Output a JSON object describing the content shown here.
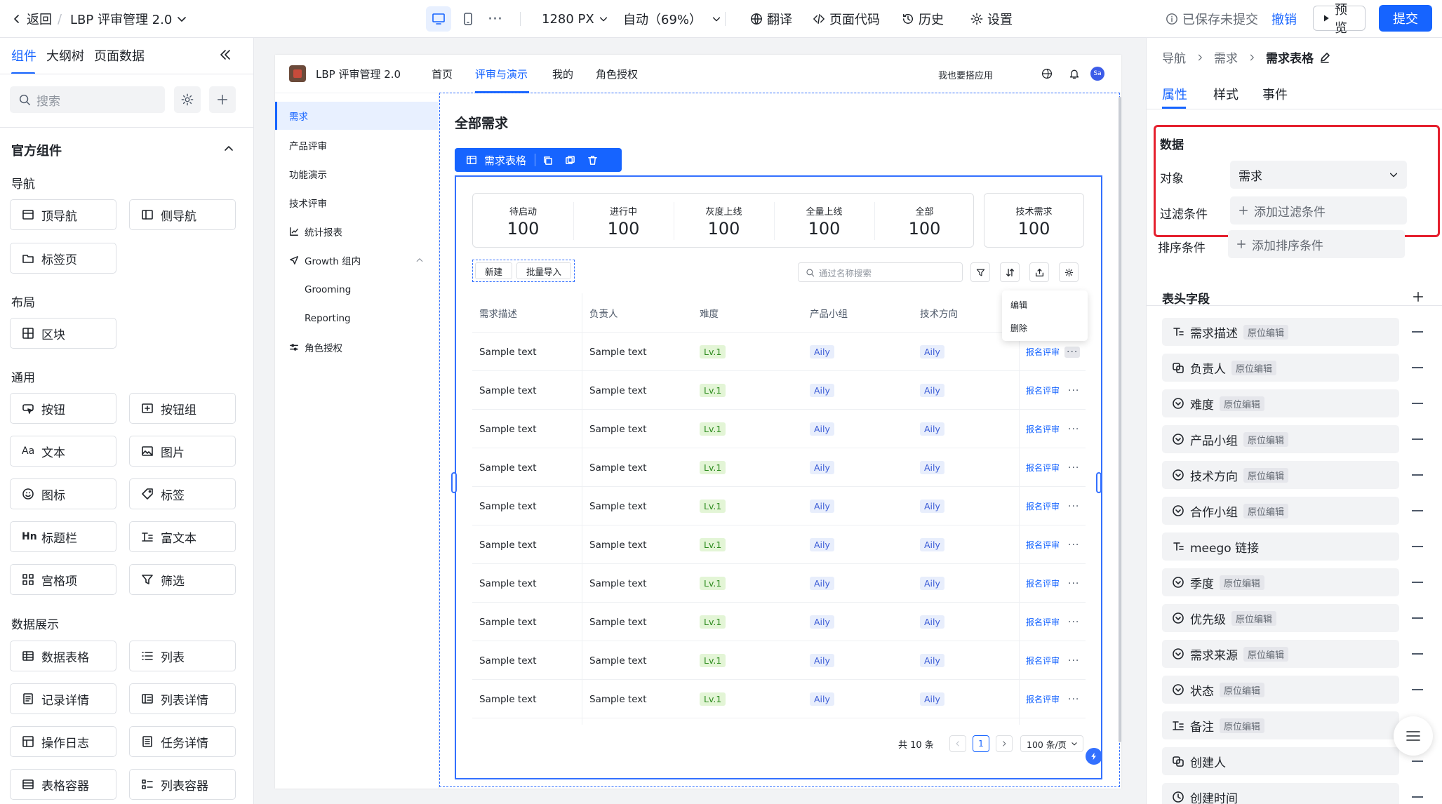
{
  "topbar": {
    "back": "返回",
    "breadcrumb_sep": "/",
    "app_title": "LBP 评审管理 2.0",
    "width": "1280 PX",
    "zoom": "自动（69%）",
    "translate": "翻译",
    "page_code": "页面代码",
    "history": "历史",
    "settings": "设置",
    "save_status": "已保存未提交",
    "undo": "撤销",
    "preview": "预览",
    "submit": "提交"
  },
  "left": {
    "tabs": [
      "组件",
      "大纲树",
      "页面数据"
    ],
    "search_placeholder": "搜索",
    "section_title": "官方组件",
    "groups": [
      {
        "title": "导航",
        "items": [
          {
            "label": "顶导航",
            "icon": "top-nav-icon"
          },
          {
            "label": "侧导航",
            "icon": "side-nav-icon"
          },
          {
            "label": "标签页",
            "icon": "tabs-icon"
          }
        ]
      },
      {
        "title": "布局",
        "items": [
          {
            "label": "区块",
            "icon": "block-icon"
          }
        ]
      },
      {
        "title": "通用",
        "items": [
          {
            "label": "按钮",
            "icon": "button-icon"
          },
          {
            "label": "按钮组",
            "icon": "button-group-icon"
          },
          {
            "label": "文本",
            "icon": "text-icon"
          },
          {
            "label": "图片",
            "icon": "image-icon"
          },
          {
            "label": "图标",
            "icon": "smiley-icon"
          },
          {
            "label": "标签",
            "icon": "tag-icon"
          },
          {
            "label": "标题栏",
            "icon": "heading-icon"
          },
          {
            "label": "富文本",
            "icon": "rich-text-icon"
          },
          {
            "label": "宫格项",
            "icon": "grid-icon"
          },
          {
            "label": "筛选",
            "icon": "filter-icon"
          }
        ]
      },
      {
        "title": "数据展示",
        "items": [
          {
            "label": "数据表格",
            "icon": "table-icon"
          },
          {
            "label": "列表",
            "icon": "list-icon"
          },
          {
            "label": "记录详情",
            "icon": "record-icon"
          },
          {
            "label": "列表详情",
            "icon": "list-detail-icon"
          },
          {
            "label": "操作日志",
            "icon": "log-icon"
          },
          {
            "label": "任务详情",
            "icon": "task-icon"
          },
          {
            "label": "表格容器",
            "icon": "table-container-icon"
          },
          {
            "label": "列表容器",
            "icon": "list-container-icon"
          }
        ]
      }
    ]
  },
  "app": {
    "title": "LBP 评审管理 2.0",
    "nav": [
      "首页",
      "评审与演示",
      "我的",
      "角色授权"
    ],
    "nav_active": 1,
    "build_app": "我也要搭应用",
    "avatar": "Sa",
    "sidebar": [
      {
        "label": "需求",
        "active": true
      },
      {
        "label": "产品评审"
      },
      {
        "label": "功能演示"
      },
      {
        "label": "技术评审"
      },
      {
        "label": "统计报表",
        "icon": "chart-icon"
      },
      {
        "label": "Growth 组内",
        "icon": "send-icon",
        "expanded": true
      },
      {
        "label": "Grooming",
        "sub": true
      },
      {
        "label": "Reporting",
        "sub": true
      },
      {
        "label": "角色授权",
        "icon": "sliders-icon"
      }
    ],
    "page_title": "全部需求",
    "selection_toolbar_label": "需求表格",
    "stats": [
      {
        "label": "待启动",
        "value": "100"
      },
      {
        "label": "进行中",
        "value": "100"
      },
      {
        "label": "灰度上线",
        "value": "100"
      },
      {
        "label": "全量上线",
        "value": "100"
      },
      {
        "label": "全部",
        "value": "100"
      }
    ],
    "stat_extra": {
      "label": "技术需求",
      "value": "100"
    },
    "btn_new": "新建",
    "btn_import": "批量导入",
    "search_placeholder": "通过名称搜索",
    "columns": [
      "需求描述",
      "负责人",
      "难度",
      "产品小组",
      "技术方向"
    ],
    "rows": [
      {
        "desc": "Sample text",
        "owner": "Sample text",
        "level": "Lv.1",
        "group": "Aily",
        "tech": "Aily",
        "action": "报名评审"
      },
      {
        "desc": "Sample text",
        "owner": "Sample text",
        "level": "Lv.1",
        "group": "Aily",
        "tech": "Aily",
        "action": "报名评审"
      },
      {
        "desc": "Sample text",
        "owner": "Sample text",
        "level": "Lv.1",
        "group": "Aily",
        "tech": "Aily",
        "action": "报名评审"
      },
      {
        "desc": "Sample text",
        "owner": "Sample text",
        "level": "Lv.1",
        "group": "Aily",
        "tech": "Aily",
        "action": "报名评审"
      },
      {
        "desc": "Sample text",
        "owner": "Sample text",
        "level": "Lv.1",
        "group": "Aily",
        "tech": "Aily",
        "action": "报名评审"
      },
      {
        "desc": "Sample text",
        "owner": "Sample text",
        "level": "Lv.1",
        "group": "Aily",
        "tech": "Aily",
        "action": "报名评审"
      },
      {
        "desc": "Sample text",
        "owner": "Sample text",
        "level": "Lv.1",
        "group": "Aily",
        "tech": "Aily",
        "action": "报名评审"
      },
      {
        "desc": "Sample text",
        "owner": "Sample text",
        "level": "Lv.1",
        "group": "Aily",
        "tech": "Aily",
        "action": "报名评审"
      },
      {
        "desc": "Sample text",
        "owner": "Sample text",
        "level": "Lv.1",
        "group": "Aily",
        "tech": "Aily",
        "action": "报名评审"
      },
      {
        "desc": "Sample text",
        "owner": "Sample text",
        "level": "Lv.1",
        "group": "Aily",
        "tech": "Aily",
        "action": "报名评审"
      }
    ],
    "menu": [
      "编辑",
      "删除"
    ],
    "total": "共 10 条",
    "page": "1",
    "page_size": "100 条/页"
  },
  "right": {
    "breadcrumb": [
      "导航",
      "需求",
      "需求表格"
    ],
    "tabs": [
      "属性",
      "样式",
      "事件"
    ],
    "data_section": "数据",
    "object_label": "对象",
    "object_value": "需求",
    "filter_label": "过滤条件",
    "filter_add": "添加过滤条件",
    "sort_label": "排序条件",
    "sort_add": "添加排序条件",
    "header_fields_title": "表头字段",
    "fields": [
      {
        "label": "需求描述",
        "badge": "原位编辑",
        "icon": "text-field-icon"
      },
      {
        "label": "负责人",
        "badge": "原位编辑",
        "icon": "user-field-icon"
      },
      {
        "label": "难度",
        "badge": "原位编辑",
        "icon": "select-field-icon"
      },
      {
        "label": "产品小组",
        "badge": "原位编辑",
        "icon": "select-field-icon"
      },
      {
        "label": "技术方向",
        "badge": "原位编辑",
        "icon": "select-field-icon"
      },
      {
        "label": "合作小组",
        "badge": "原位编辑",
        "icon": "select-field-icon"
      },
      {
        "label": "meego 链接",
        "badge": "",
        "icon": "text-field-icon"
      },
      {
        "label": "季度",
        "badge": "原位编辑",
        "icon": "select-field-icon"
      },
      {
        "label": "优先级",
        "badge": "原位编辑",
        "icon": "select-field-icon"
      },
      {
        "label": "需求来源",
        "badge": "原位编辑",
        "icon": "select-field-icon"
      },
      {
        "label": "状态",
        "badge": "原位编辑",
        "icon": "select-field-icon"
      },
      {
        "label": "备注",
        "badge": "原位编辑",
        "icon": "rich-text-field-icon"
      },
      {
        "label": "创建人",
        "badge": "",
        "icon": "user-field-icon"
      },
      {
        "label": "创建时间",
        "badge": "",
        "icon": "clock-field-icon"
      }
    ]
  },
  "colors": {
    "accent": "#1664ff",
    "highlight": "#e5202e"
  }
}
